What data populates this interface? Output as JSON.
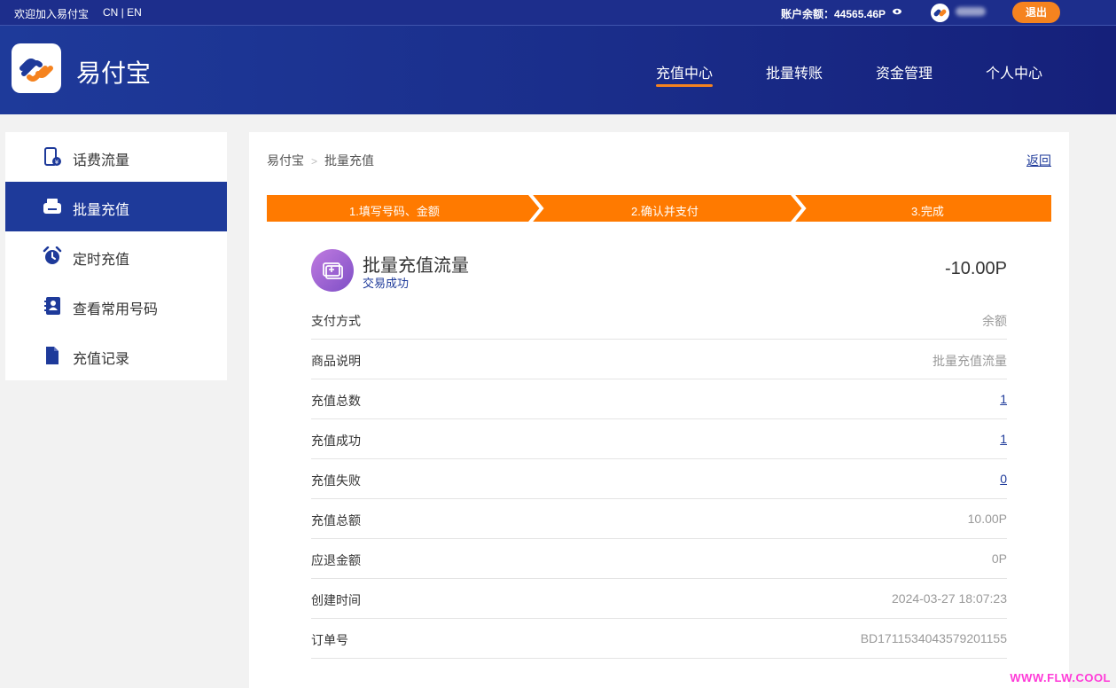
{
  "topbar": {
    "welcome": "欢迎加入易付宝",
    "lang": "CN | EN",
    "balance": "账户余额：44565.46P",
    "logout": "退出"
  },
  "header": {
    "brand": "易付宝",
    "nav": [
      {
        "label": "充值中心",
        "active": true
      },
      {
        "label": "批量转账",
        "active": false
      },
      {
        "label": "资金管理",
        "active": false
      },
      {
        "label": "个人中心",
        "active": false
      }
    ]
  },
  "sidebar": {
    "items": [
      {
        "label": "话费流量",
        "icon": "phone-icon",
        "active": false
      },
      {
        "label": "批量充值",
        "icon": "printer-icon",
        "active": true
      },
      {
        "label": "定时充值",
        "icon": "alarm-clock-icon",
        "active": false
      },
      {
        "label": "查看常用号码",
        "icon": "contact-book-icon",
        "active": false
      },
      {
        "label": "充值记录",
        "icon": "document-icon",
        "active": false
      }
    ]
  },
  "main": {
    "breadcrumb": [
      "易付宝",
      "批量充值"
    ],
    "back": "返回",
    "steps": [
      "1.填写号码、金额",
      "2.确认并支付",
      "3.完成"
    ],
    "transaction": {
      "title": "批量充值流量",
      "status": "交易成功",
      "amount": "-10.00P"
    },
    "details": [
      {
        "label": "支付方式",
        "value": "余额",
        "link": false
      },
      {
        "label": "商品说明",
        "value": "批量充值流量",
        "link": false
      },
      {
        "label": "充值总数",
        "value": "1",
        "link": true
      },
      {
        "label": "充值成功",
        "value": "1",
        "link": true
      },
      {
        "label": "充值失败",
        "value": "0",
        "link": true
      },
      {
        "label": "充值总额",
        "value": "10.00P",
        "link": false
      },
      {
        "label": "应退金额",
        "value": "0P",
        "link": false
      },
      {
        "label": "创建时间",
        "value": "2024-03-27 18:07:23",
        "link": false
      },
      {
        "label": "订单号",
        "value": "BD1711534043579201155",
        "link": false
      }
    ]
  },
  "watermark": "WWW.FLW.COOL",
  "colors": {
    "primary": "#1e3a9a",
    "accent": "#f5831f",
    "step": "#ff7a00"
  }
}
